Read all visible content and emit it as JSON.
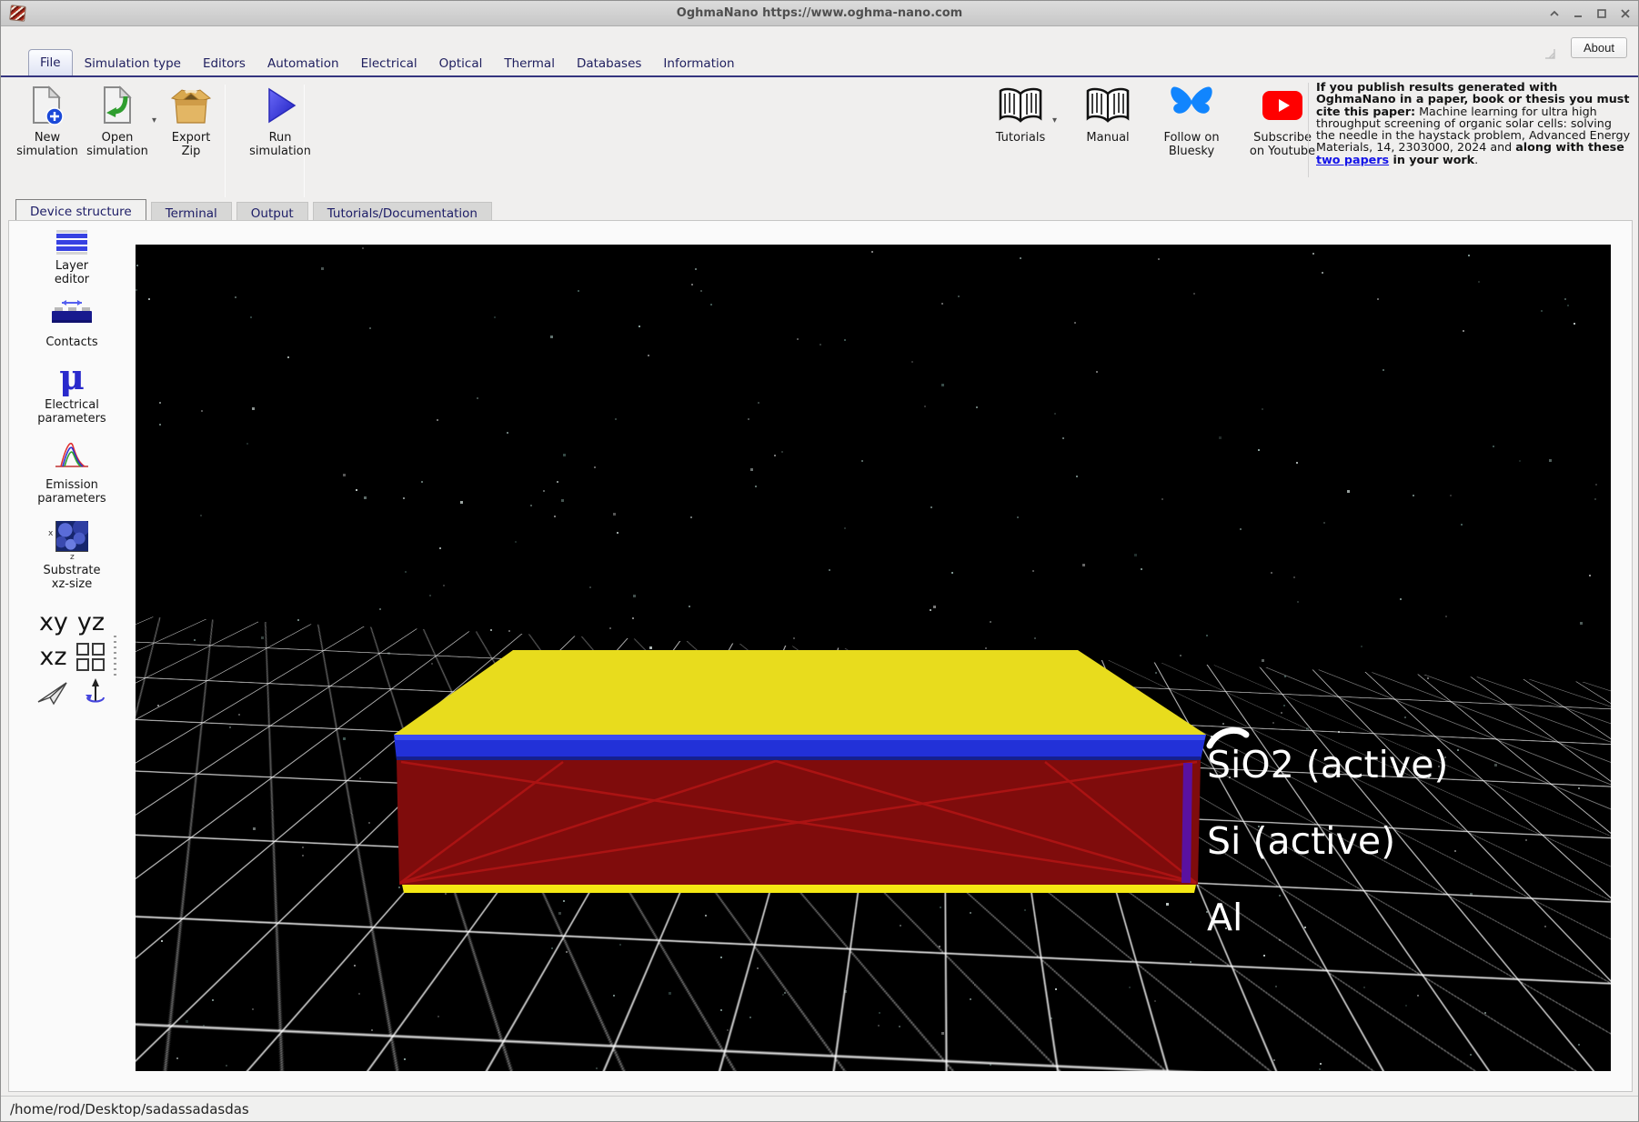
{
  "titlebar": {
    "title": "OghmaNano https://www.oghma-nano.com"
  },
  "menubar": {
    "tabs": [
      "File",
      "Simulation type",
      "Editors",
      "Automation",
      "Electrical",
      "Optical",
      "Thermal",
      "Databases",
      "Information"
    ],
    "active": "File",
    "about": "About"
  },
  "toolbar": {
    "new_sim": "New\nsimulation",
    "open_sim": "Open\nsimulation",
    "export_zip": "Export\nZip",
    "run_sim": "Run\nsimulation",
    "tutorials": "Tutorials",
    "manual": "Manual",
    "bluesky": "Follow on\nBluesky",
    "youtube": "Subscribe\non Youtube"
  },
  "citation": {
    "bold_intro": "If you publish results generated with OghmaNano in a paper, book or thesis you must cite this paper:",
    "body": " Machine learning for ultra high throughput screening of organic solar cells: solving the needle in the haystack problem, Advanced Energy Materials, 14, 2303000, 2024 and ",
    "bold_mid": "along with these ",
    "link": "two papers",
    "bold_end": " in your work",
    "period": "."
  },
  "doc_tabs": {
    "tabs": [
      "Device structure",
      "Terminal",
      "Output",
      "Tutorials/Documentation"
    ],
    "active": "Device structure"
  },
  "sidebar": {
    "items": [
      {
        "label": "Layer\neditor"
      },
      {
        "label": "Contacts"
      },
      {
        "label": "Electrical\nparameters"
      },
      {
        "label": "Emission\nparameters"
      },
      {
        "label": "Substrate\nxz-size"
      }
    ],
    "views": {
      "xy": "xy",
      "yz": "yz",
      "xz": "xz"
    }
  },
  "scene": {
    "layer_labels": [
      "SiO2 (active)",
      "Si (active)",
      "Al"
    ],
    "colors": {
      "top_contact": "#e8dc1d",
      "oxide_strip": "#2231d8",
      "body": "#7f0c0c",
      "right_edge": "#5a11a0",
      "bottom_contact": "#f4e813",
      "grid_line": "#ffffff"
    }
  },
  "statusbar": {
    "path": "/home/rod/Desktop/sadassadasdas"
  }
}
